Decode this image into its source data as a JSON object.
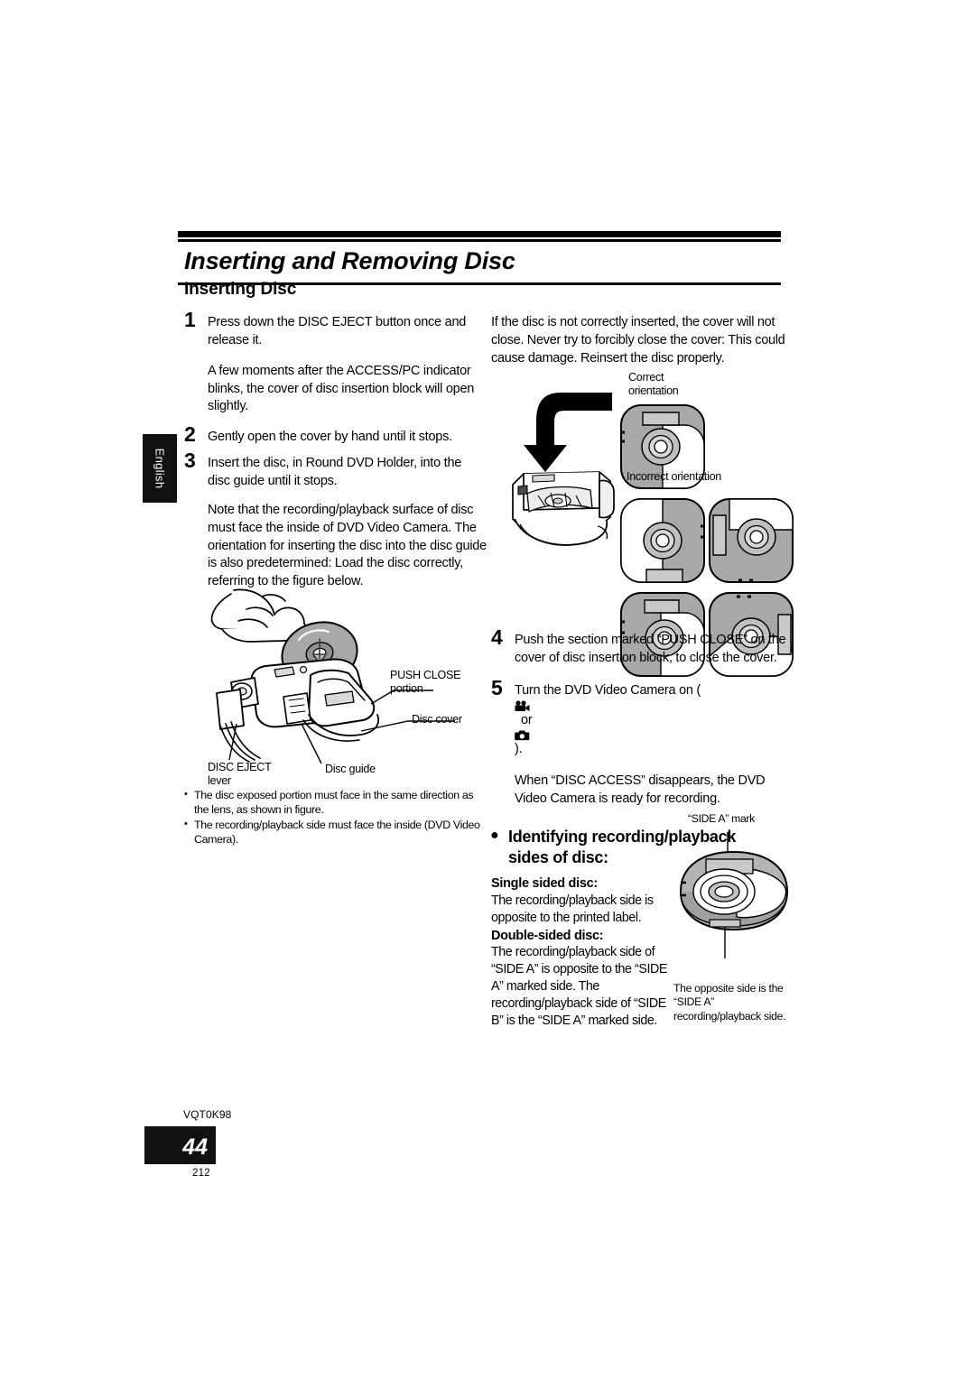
{
  "document": {
    "title": "Inserting and Removing Disc",
    "section_heading": "Inserting Disc",
    "language_tab": "English"
  },
  "left_column": {
    "step1": {
      "number": "1",
      "text": "Press down the DISC EJECT button once and release it."
    },
    "step1_note": "A few moments after the ACCESS/PC indicator blinks, the cover of disc insertion block will open slightly.",
    "step2": {
      "number": "2",
      "text": "Gently open the cover by hand until it stops."
    },
    "step3": {
      "number": "3",
      "text": "Insert the disc, in Round DVD Holder, into the disc guide until it stops."
    },
    "step3_note": "Note that the recording/playback surface of disc must face the inside of DVD Video Camera. The orientation for inserting the disc into the disc guide is also predetermined: Load the disc correctly, referring to the figure below.",
    "figure_labels": {
      "push_close": "PUSH CLOSE\nportion",
      "disc_cover": "Disc cover",
      "disc_eject": "DISC EJECT\nlever",
      "disc_guide": "Disc guide"
    },
    "bullets": [
      "The disc exposed portion must face in the same direction as the lens, as shown in figure.",
      "The recording/playback side must face the inside (DVD Video Camera)."
    ]
  },
  "right_column": {
    "warning": "If the disc is not correctly inserted, the cover will not close. Never try to forcibly close the cover: This could cause damage. Reinsert the disc properly.",
    "figure_labels": {
      "correct": "Correct\norientation",
      "incorrect": "Incorrect orientation"
    },
    "step4": {
      "number": "4",
      "text": "Push the section marked “PUSH  CLOSE” on the cover of disc insertion block, to close the cover."
    },
    "step5": {
      "number": "5",
      "text_before": "Turn the DVD Video Camera on (",
      "text_or": "or",
      "text_after": ")."
    },
    "step5_note": "When “DISC ACCESS” disappears, the DVD Video Camera is ready for recording.",
    "identifying_heading": "Identifying recording/playback sides of disc:",
    "single_sided_label": "Single sided disc:",
    "single_sided_text": "The recording/playback side is opposite to the printed label.",
    "double_sided_label": "Double-sided disc:",
    "double_sided_text": "The recording/playback side of “SIDE A” is opposite to the “SIDE A” marked side. The recording/playback side of “SIDE B” is the “SIDE A” marked side.",
    "disc_figure_labels": {
      "side_a_mark": "“SIDE A” mark",
      "opposite_side": "The opposite side is the “SIDE A” recording/playback side."
    }
  },
  "footer": {
    "manual_code": "VQT0K98",
    "page_number": "44",
    "sub_number": "212"
  },
  "colors": {
    "ink": "#000000",
    "paper": "#ffffff",
    "tab_bg": "#111111",
    "disc_gray": "#a8a8a8",
    "disc_gray_light": "#c9c9c9"
  }
}
